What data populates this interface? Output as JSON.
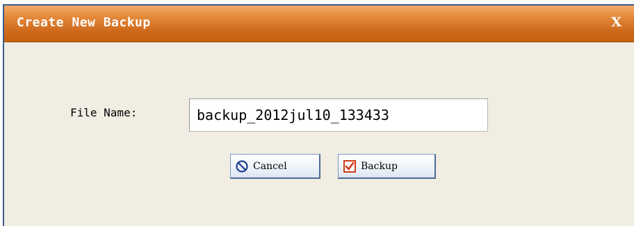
{
  "dialog": {
    "title": "Create New Backup",
    "close_label": "X"
  },
  "form": {
    "file_name_label": "File Name:",
    "file_name_value": "backup_2012jul10_133433"
  },
  "buttons": {
    "cancel": {
      "label": "Cancel",
      "icon": "no-entry-icon",
      "icon_color": "#1c3f8f"
    },
    "backup": {
      "label": "Backup",
      "icon": "checkbox-checked-icon",
      "icon_color": "#d03a1a"
    }
  },
  "colors": {
    "titlebar": "#d9731f",
    "dialog_background": "#f1ede3",
    "window_border": "#3b5b8c"
  }
}
